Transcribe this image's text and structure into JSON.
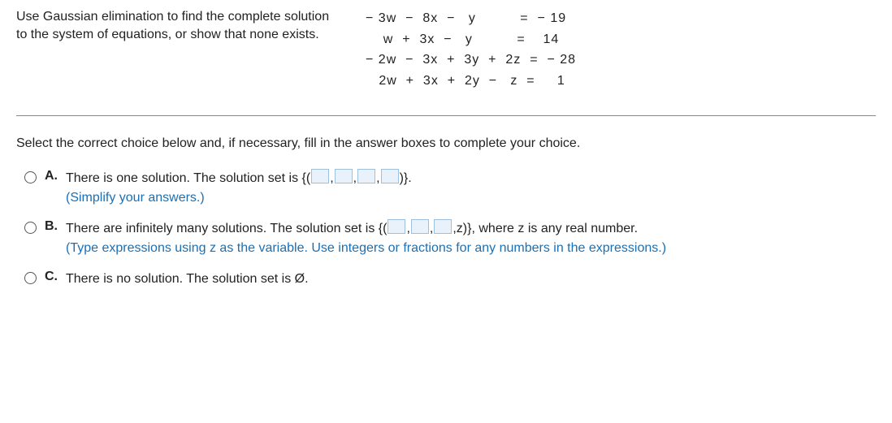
{
  "prompt": "Use Gaussian elimination to find the complete solution to the system of equations, or show that none exists.",
  "equations": {
    "l1": "− 3w  −  8x  −   y          =  − 19",
    "l2": "    w  +  3x  −   y          =    14",
    "l3": "− 2w  −  3x  +  3y  +  2z  =  − 28",
    "l4": "   2w  +  3x  +  2y  −   z  =     1"
  },
  "instruction": "Select the correct choice below and, if necessary, fill in the answer boxes to complete your choice.",
  "choices": {
    "A": {
      "letter": "A.",
      "t1": "There is one solution. The solution set is ",
      "set_open": "{(",
      "comma": ",",
      "set_close": ")}.",
      "hint": "(Simplify your answers.)"
    },
    "B": {
      "letter": "B.",
      "t1": "There are infinitely many solutions. The solution set is ",
      "set_open": "{(",
      "comma": ",",
      "tail": ",z)},",
      "after": " where z is any real number.",
      "hint": "(Type expressions using z as the variable. Use integers or fractions for any numbers in the expressions.)"
    },
    "C": {
      "letter": "C.",
      "t1": "There is no solution. The solution set is Ø."
    }
  }
}
